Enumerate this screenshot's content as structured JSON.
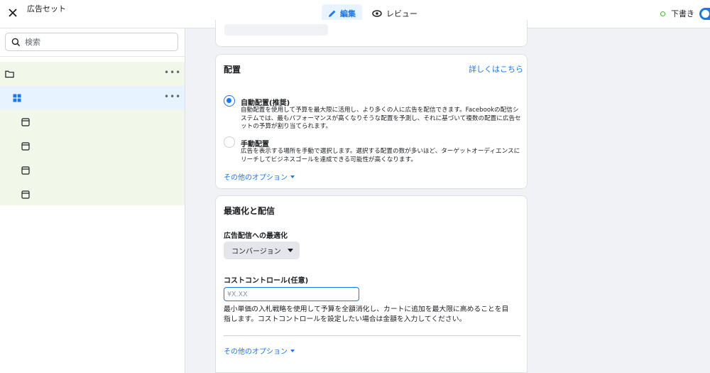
{
  "header": {
    "title": "広告セット",
    "tabs": [
      {
        "label": "編集",
        "icon": "pencil-icon",
        "active": true
      },
      {
        "label": "レビュー",
        "icon": "eye-icon",
        "active": false
      }
    ],
    "status": "下書き"
  },
  "sidebar": {
    "search_placeholder": "検索",
    "tree": [
      {
        "icon": "folder-icon",
        "more": "•••",
        "level": 0
      },
      {
        "icon": "grid-icon",
        "more": "•••",
        "level": 1,
        "selected": true
      },
      {
        "icon": "ad-icon",
        "level": 2
      },
      {
        "icon": "ad-icon",
        "level": 2
      },
      {
        "icon": "ad-icon",
        "level": 2
      },
      {
        "icon": "ad-icon",
        "level": 2
      }
    ]
  },
  "placement": {
    "title": "配置",
    "learn_more": "詳しくはこちら",
    "options": [
      {
        "title": "自動配置(推奨)",
        "desc": "自動配置を使用して予算を最大限に活用し、より多くの人に広告を配信できます。Facebookの配信システムでは、最もパフォーマンスが高くなりそうな配置を予測し、それに基づいて複数の配置に広告セットの予算が割り当てられます。",
        "checked": true
      },
      {
        "title": "手動配置",
        "desc": "広告を表示する場所を手動で選択します。選択する配置の数が多いほど、ターゲットオーディエンスにリーチしてビジネスゴールを達成できる可能性が高くなります。",
        "checked": false
      }
    ],
    "more_options": "その他のオプション"
  },
  "optimization": {
    "title": "最適化と配信",
    "delivery_label": "広告配信への最適化",
    "delivery_value": "コンバージョン",
    "cost_label": "コストコントロール(任意)",
    "cost_placeholder": "¥X.XX",
    "help": "最小単価の入札戦略を使用して予算を全額消化し、カートに追加を最大限に高めることを目指します。コストコントロールを設定したい場合は金額を入力してください。",
    "more_options": "その他のオプション"
  },
  "colors": {
    "accent": "#1877f2",
    "tree_bg": "#f1f8e9",
    "selected_bg": "#e7f3ff",
    "status_green": "#42b72a"
  }
}
